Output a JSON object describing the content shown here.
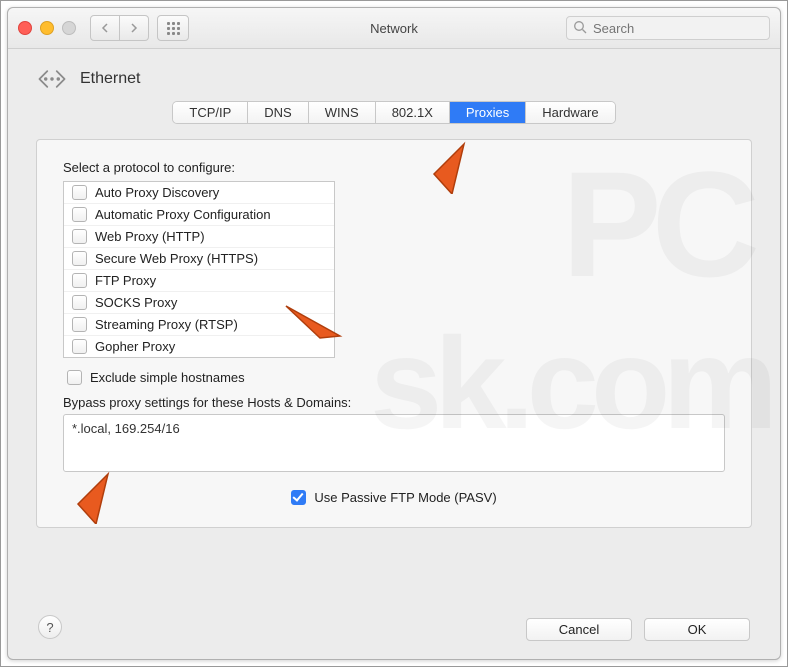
{
  "window_title": "Network",
  "search_placeholder": "Search",
  "header_title": "Ethernet",
  "tabs": [
    "TCP/IP",
    "DNS",
    "WINS",
    "802.1X",
    "Proxies",
    "Hardware"
  ],
  "active_tab_index": 4,
  "protocol_label": "Select a protocol to configure:",
  "protocols": [
    "Auto Proxy Discovery",
    "Automatic Proxy Configuration",
    "Web Proxy (HTTP)",
    "Secure Web Proxy (HTTPS)",
    "FTP Proxy",
    "SOCKS Proxy",
    "Streaming Proxy (RTSP)",
    "Gopher Proxy"
  ],
  "exclude_label": "Exclude simple hostnames",
  "bypass_label": "Bypass proxy settings for these Hosts & Domains:",
  "bypass_value": "*.local, 169.254/16",
  "pasv_label": "Use Passive FTP Mode (PASV)",
  "help_label": "?",
  "cancel_label": "Cancel",
  "ok_label": "OK"
}
